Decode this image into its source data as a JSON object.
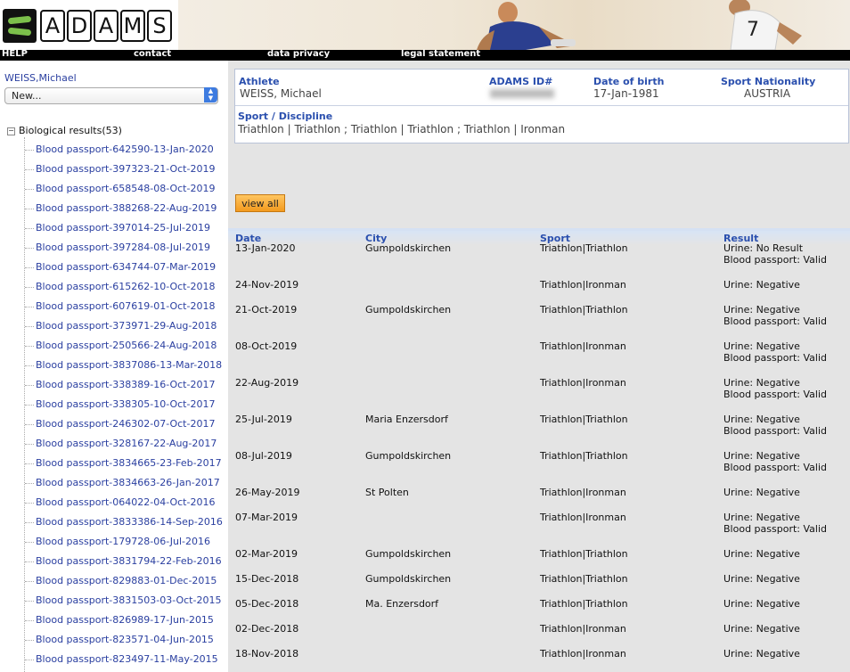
{
  "app": {
    "logo_text": [
      "A",
      "D",
      "A",
      "M",
      "S"
    ]
  },
  "nav": {
    "items": [
      "HELP",
      "contact",
      "data privacy",
      "legal statement"
    ]
  },
  "sidebar": {
    "athlete_link": "WEISS,Michael",
    "select_value": "New...",
    "tree_root": "Biological results(53)",
    "items": [
      "Blood passport-642590-13-Jan-2020",
      "Blood passport-397323-21-Oct-2019",
      "Blood passport-658548-08-Oct-2019",
      "Blood passport-388268-22-Aug-2019",
      "Blood passport-397014-25-Jul-2019",
      "Blood passport-397284-08-Jul-2019",
      "Blood passport-634744-07-Mar-2019",
      "Blood passport-615262-10-Oct-2018",
      "Blood passport-607619-01-Oct-2018",
      "Blood passport-373971-29-Aug-2018",
      "Blood passport-250566-24-Aug-2018",
      "Blood passport-3837086-13-Mar-2018",
      "Blood passport-338389-16-Oct-2017",
      "Blood passport-338305-10-Oct-2017",
      "Blood passport-246302-07-Oct-2017",
      "Blood passport-328167-22-Aug-2017",
      "Blood passport-3834665-23-Feb-2017",
      "Blood passport-3834663-26-Jan-2017",
      "Blood passport-064022-04-Oct-2016",
      "Blood passport-3833386-14-Sep-2016",
      "Blood passport-179728-06-Jul-2016",
      "Blood passport-3831794-22-Feb-2016",
      "Blood passport-829883-01-Dec-2015",
      "Blood passport-3831503-03-Oct-2015",
      "Blood passport-826989-17-Jun-2015",
      "Blood passport-823571-04-Jun-2015",
      "Blood passport-823497-11-May-2015"
    ]
  },
  "athlete": {
    "athlete_label": "Athlete",
    "athlete_value": "WEISS, Michael",
    "adams_id_label": "ADAMS ID#",
    "adams_id_value": "",
    "dob_label": "Date of birth",
    "dob_value": "17-Jan-1981",
    "nationality_label": "Sport Nationality",
    "nationality_value": "AUSTRIA",
    "discipline_label": "Sport / Discipline",
    "discipline_value": "Triathlon | Triathlon ; Triathlon | Triathlon ; Triathlon | Ironman"
  },
  "view_all_label": "view all",
  "results": {
    "headers": {
      "date": "Date",
      "city": "City",
      "sport": "Sport",
      "result": "Result"
    },
    "rows": [
      {
        "date": "13-Jan-2020",
        "city": "Gumpoldskirchen",
        "sport": "Triathlon|Triathlon",
        "result": [
          "Urine: No Result",
          "Blood passport: Valid"
        ]
      },
      {
        "date": "24-Nov-2019",
        "city": "",
        "sport": "Triathlon|Ironman",
        "result": [
          "Urine: Negative"
        ]
      },
      {
        "date": "21-Oct-2019",
        "city": "Gumpoldskirchen",
        "sport": "Triathlon|Triathlon",
        "result": [
          "Urine: Negative",
          "Blood passport: Valid"
        ]
      },
      {
        "date": "08-Oct-2019",
        "city": "",
        "sport": "Triathlon|Ironman",
        "result": [
          "Urine: Negative",
          "Blood passport: Valid"
        ]
      },
      {
        "date": "22-Aug-2019",
        "city": "",
        "sport": "Triathlon|Ironman",
        "result": [
          "Urine: Negative",
          "Blood passport: Valid"
        ]
      },
      {
        "date": "25-Jul-2019",
        "city": "Maria Enzersdorf",
        "sport": "Triathlon|Triathlon",
        "result": [
          "Urine: Negative",
          "Blood passport: Valid"
        ]
      },
      {
        "date": "08-Jul-2019",
        "city": "Gumpoldskirchen",
        "sport": "Triathlon|Triathlon",
        "result": [
          "Urine: Negative",
          "Blood passport: Valid"
        ]
      },
      {
        "date": "26-May-2019",
        "city": "St Polten",
        "sport": "Triathlon|Ironman",
        "result": [
          "Urine: Negative"
        ]
      },
      {
        "date": "07-Mar-2019",
        "city": "",
        "sport": "Triathlon|Ironman",
        "result": [
          "Urine: Negative",
          "Blood passport: Valid"
        ]
      },
      {
        "date": "02-Mar-2019",
        "city": "Gumpoldskirchen",
        "sport": "Triathlon|Triathlon",
        "result": [
          "Urine: Negative"
        ]
      },
      {
        "date": "15-Dec-2018",
        "city": "Gumpoldskirchen",
        "sport": "Triathlon|Triathlon",
        "result": [
          "Urine: Negative"
        ]
      },
      {
        "date": "05-Dec-2018",
        "city": "Ma. Enzersdorf",
        "sport": "Triathlon|Triathlon",
        "result": [
          "Urine: Negative"
        ]
      },
      {
        "date": "02-Dec-2018",
        "city": "",
        "sport": "Triathlon|Ironman",
        "result": [
          "Urine: Negative"
        ]
      },
      {
        "date": "18-Nov-2018",
        "city": "",
        "sport": "Triathlon|Ironman",
        "result": [
          "Urine: Negative"
        ]
      }
    ]
  },
  "colors": {
    "link": "#2a3fa0",
    "label": "#2a4fae",
    "accent_green": "#7cc04b",
    "button_orange": "#f39a1e"
  }
}
